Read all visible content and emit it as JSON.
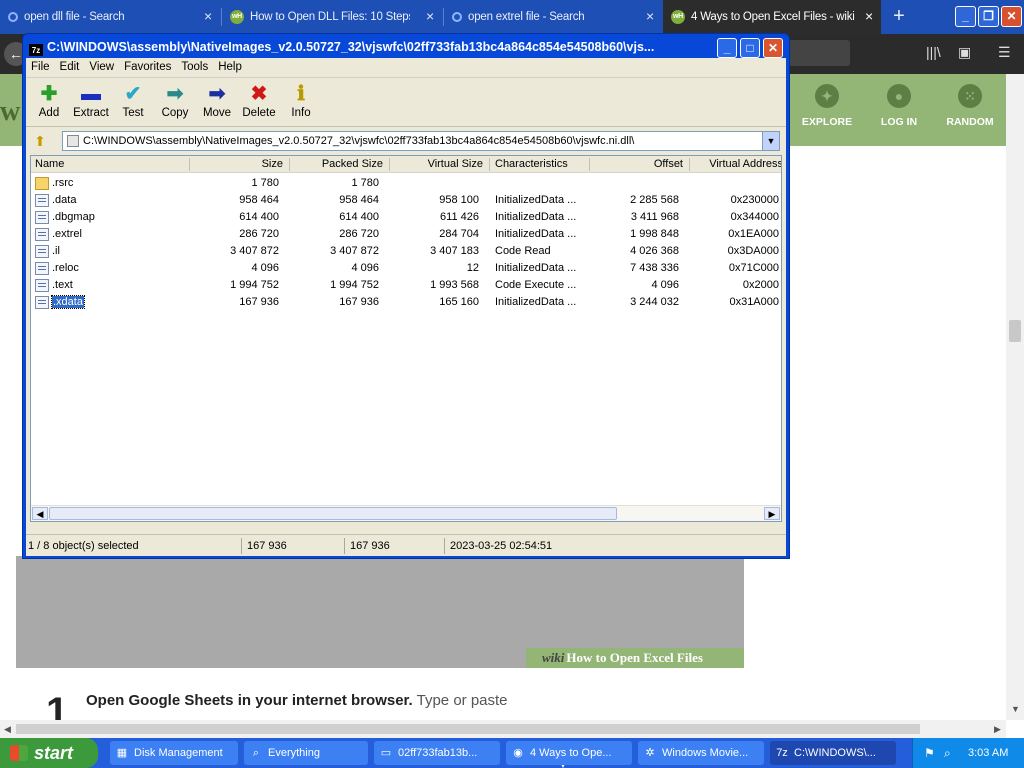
{
  "browser": {
    "tabs": [
      {
        "label": "open dll file - Search",
        "icon": "search-icon"
      },
      {
        "label": "How to Open DLL Files: 10 Steps",
        "icon": "wikihow-icon"
      },
      {
        "label": "open extrel file - Search",
        "icon": "search-icon"
      },
      {
        "label": "4 Ways to Open Excel Files - wiki",
        "icon": "wikihow-icon"
      }
    ],
    "new_tab": "+",
    "controls": {
      "minimize": "_",
      "restore": "❐",
      "close": "✕"
    }
  },
  "page": {
    "logo_letter": "w",
    "nav": [
      {
        "label": "EXPLORE",
        "icon": "compass-icon"
      },
      {
        "label": "LOG IN",
        "icon": "user-icon"
      },
      {
        "label": "RANDOM",
        "icon": "dice-icon"
      }
    ],
    "banner": {
      "wiki": "wiki",
      "how": "How to Open Excel Files"
    },
    "step": {
      "number": "1",
      "bold": "Open Google Sheets in your internet browser.",
      "rest": " Type or paste"
    }
  },
  "zip": {
    "title": "C:\\WINDOWS\\assembly\\NativeImages_v2.0.50727_32\\vjswfc\\02ff733fab13bc4a864c854e54508b60\\vjs...",
    "app_icon": "7z",
    "menu": [
      "File",
      "Edit",
      "View",
      "Favorites",
      "Tools",
      "Help"
    ],
    "toolbar": [
      {
        "label": "Add",
        "icon": "add-icon",
        "glyph": "✚",
        "color": "#2aa02a"
      },
      {
        "label": "Extract",
        "icon": "extract-icon",
        "glyph": "▬",
        "color": "#1b2fbf"
      },
      {
        "label": "Test",
        "icon": "test-icon",
        "glyph": "✔",
        "color": "#2aa8c8"
      },
      {
        "label": "Copy",
        "icon": "copy-icon",
        "glyph": "➡",
        "color": "#2a8a8a"
      },
      {
        "label": "Move",
        "icon": "move-icon",
        "glyph": "➡",
        "color": "#1b2f9f"
      },
      {
        "label": "Delete",
        "icon": "delete-icon",
        "glyph": "✖",
        "color": "#d01818"
      },
      {
        "label": "Info",
        "icon": "info-icon",
        "glyph": "ℹ",
        "color": "#b89a00"
      }
    ],
    "address": "C:\\WINDOWS\\assembly\\NativeImages_v2.0.50727_32\\vjswfc\\02ff733fab13bc4a864c854e54508b60\\vjswfc.ni.dll\\",
    "columns": [
      "Name",
      "Size",
      "Packed Size",
      "Virtual Size",
      "Characteristics",
      "Offset",
      "Virtual Address"
    ],
    "rows": [
      {
        "name": ".rsrc",
        "size": "1 780",
        "packed": "1 780",
        "vsize": "",
        "chars": "",
        "offset": "",
        "vaddr": "",
        "folder": true
      },
      {
        "name": ".data",
        "size": "958 464",
        "packed": "958 464",
        "vsize": "958 100",
        "chars": "InitializedData ...",
        "offset": "2 285 568",
        "vaddr": "0x230000"
      },
      {
        "name": ".dbgmap",
        "size": "614 400",
        "packed": "614 400",
        "vsize": "611 426",
        "chars": "InitializedData ...",
        "offset": "3 411 968",
        "vaddr": "0x344000"
      },
      {
        "name": ".extrel",
        "size": "286 720",
        "packed": "286 720",
        "vsize": "284 704",
        "chars": "InitializedData ...",
        "offset": "1 998 848",
        "vaddr": "0x1EA000"
      },
      {
        "name": ".il",
        "size": "3 407 872",
        "packed": "3 407 872",
        "vsize": "3 407 183",
        "chars": "Code Read",
        "offset": "4 026 368",
        "vaddr": "0x3DA000"
      },
      {
        "name": ".reloc",
        "size": "4 096",
        "packed": "4 096",
        "vsize": "12",
        "chars": "InitializedData ...",
        "offset": "7 438 336",
        "vaddr": "0x71C000"
      },
      {
        "name": ".text",
        "size": "1 994 752",
        "packed": "1 994 752",
        "vsize": "1 993 568",
        "chars": "Code Execute ...",
        "offset": "4 096",
        "vaddr": "0x2000"
      },
      {
        "name": ".xdata",
        "size": "167 936",
        "packed": "167 936",
        "vsize": "165 160",
        "chars": "InitializedData ...",
        "offset": "3 244 032",
        "vaddr": "0x31A000",
        "selected": true
      }
    ],
    "status": {
      "selection": "1 / 8 object(s) selected",
      "size": "167 936",
      "packed": "167 936",
      "modified": "2023-03-25 02:54:51"
    }
  },
  "taskbar": {
    "start": "start",
    "tasks": [
      {
        "label": "Disk Management",
        "icon": "disk-management-icon",
        "glyph": "▦"
      },
      {
        "label": "Everything",
        "icon": "everything-search-icon",
        "glyph": "⌕"
      },
      {
        "label": "02ff733fab13b...",
        "icon": "folder-icon",
        "glyph": "▭"
      },
      {
        "label": "4 Ways to Ope...",
        "icon": "browser-icon",
        "glyph": "◉"
      },
      {
        "label": "Windows Movie...",
        "icon": "movie-maker-icon",
        "glyph": "✲"
      },
      {
        "label": "C:\\WINDOWS\\...",
        "icon": "7zip-icon",
        "glyph": "7z",
        "active": true
      }
    ],
    "clock": "3:03 AM"
  }
}
